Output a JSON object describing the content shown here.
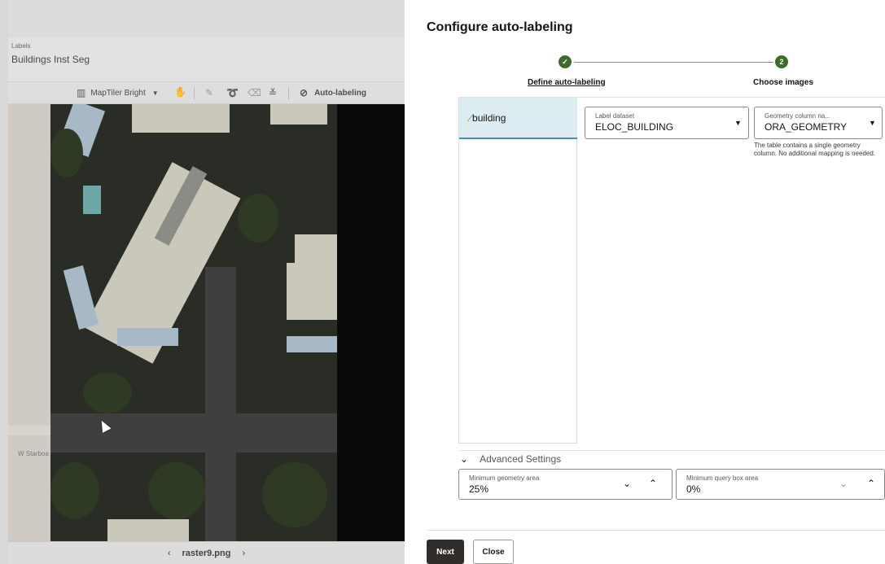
{
  "left_panel": {
    "labels_caption": "Labels",
    "labels_value": "Buildings Inst Seg",
    "toolbar": {
      "basemap_label": "MapTiler Bright",
      "basemap_icon": "map-icon",
      "autolabel_label": "Auto-labeling",
      "tools": [
        "hand-icon",
        "pencil-icon",
        "lasso-icon",
        "eraser-icon",
        "sliders-icon",
        "tag-icon"
      ]
    },
    "map_street_label": "W Starboa",
    "footer": {
      "prev": "‹",
      "filename": "raster9.png",
      "next": "›"
    }
  },
  "dialog": {
    "title": "Configure auto-labeling",
    "steps": [
      {
        "marker": "✓",
        "label": "Define auto-labeling",
        "state": "completed"
      },
      {
        "marker": "2",
        "label": "Choose images",
        "state": "pending"
      }
    ],
    "label_item": "building",
    "label_dataset": {
      "label": "Label dataset",
      "value": "ELOC_BUILDING"
    },
    "geometry_column": {
      "label": "Geometry column na...",
      "value": "ORA_GEOMETRY"
    },
    "help_text": "The table contains a single geometry column. No additional mapping is needed.",
    "advanced_settings": "Advanced Settings",
    "min_geometry_area": {
      "label": "Minimum geometry area",
      "value": "25%"
    },
    "min_query_box_area": {
      "label": "Minimum query box area",
      "value": "0%"
    },
    "buttons": {
      "next": "Next",
      "close": "Close"
    }
  },
  "colors": {
    "accent_green": "#3c6b2a",
    "selected_bg": "#dcecf1",
    "primary_button": "#312d2a"
  }
}
